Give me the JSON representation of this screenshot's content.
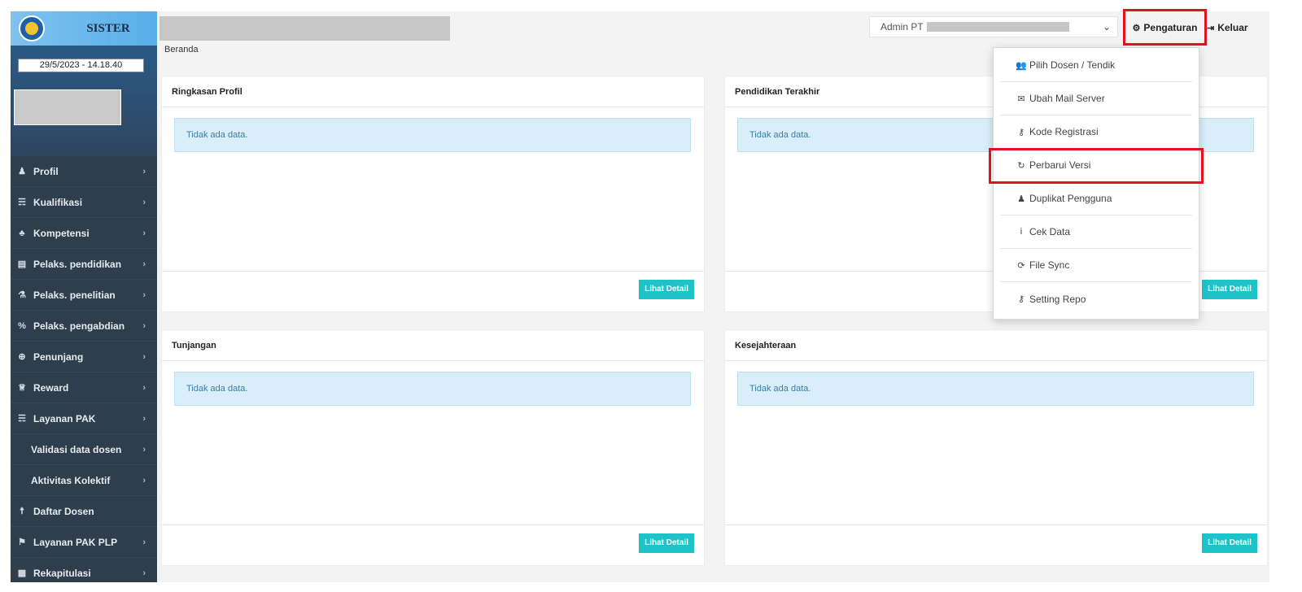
{
  "sidebar": {
    "brand": "SISTER",
    "datetime": "29/5/2023 - 14.18.40",
    "items": [
      {
        "label": "Profil",
        "icon": "user-icon",
        "glyph": "♟",
        "chevron": true
      },
      {
        "label": "Kualifikasi",
        "icon": "graduation-cap-icon",
        "glyph": "☴",
        "chevron": true
      },
      {
        "label": "Kompetensi",
        "icon": "group-icon",
        "glyph": "♣",
        "chevron": true
      },
      {
        "label": "Pelaks. pendidikan",
        "icon": "book-icon",
        "glyph": "▤",
        "chevron": true
      },
      {
        "label": "Pelaks. penelitian",
        "icon": "flask-icon",
        "glyph": "⚗",
        "chevron": true
      },
      {
        "label": "Pelaks. pengabdian",
        "icon": "percent-icon",
        "glyph": "%",
        "chevron": true
      },
      {
        "label": "Penunjang",
        "icon": "globe-icon",
        "glyph": "⊕",
        "chevron": true
      },
      {
        "label": "Reward",
        "icon": "trophy-icon",
        "glyph": "♕",
        "chevron": true
      },
      {
        "label": "Layanan PAK",
        "icon": "graduation-cap-icon",
        "glyph": "☴",
        "chevron": true
      },
      {
        "label": "Validasi data dosen",
        "icon": "",
        "glyph": "",
        "chevron": true,
        "sub": true
      },
      {
        "label": "Aktivitas Kolektif",
        "icon": "",
        "glyph": "",
        "chevron": true,
        "sub": true
      },
      {
        "label": "Daftar Dosen",
        "icon": "person-icon",
        "glyph": "☨",
        "chevron": false
      },
      {
        "label": "Layanan PAK PLP",
        "icon": "flag-icon",
        "glyph": "⚑",
        "chevron": true
      },
      {
        "label": "Rekapitulasi",
        "icon": "table-icon",
        "glyph": "▦",
        "chevron": true
      }
    ],
    "chevron_glyph": "›"
  },
  "topbar": {
    "breadcrumb": "Beranda",
    "user_prefix": "Admin PT",
    "caret": "⌄",
    "settings_label": "Pengaturan",
    "settings_glyph": "⚙",
    "logout_label": "Keluar",
    "logout_glyph": "⇥"
  },
  "panels": {
    "profil": {
      "title": "Ringkasan Profil",
      "empty": "Tidak ada data.",
      "button": "Lihat Detail"
    },
    "pendidikan": {
      "title": "Pendidikan Terakhir",
      "empty": "Tidak ada data.",
      "button": "Lihat Detail"
    },
    "tunjangan": {
      "title": "Tunjangan",
      "empty": "Tidak ada data.",
      "button": "Lihat Detail"
    },
    "kesejahteraan": {
      "title": "Kesejahteraan",
      "empty": "Tidak ada data.",
      "button": "Lihat Detail"
    }
  },
  "dropdown": {
    "items": [
      {
        "label": "Pilih Dosen / Tendik",
        "icon": "users-icon",
        "glyph": "👥"
      },
      {
        "label": "Ubah Mail Server",
        "icon": "envelope-icon",
        "glyph": "✉"
      },
      {
        "label": "Kode Registrasi",
        "icon": "key-icon",
        "glyph": "⚷"
      },
      {
        "label": "Perbarui Versi",
        "icon": "refresh-icon",
        "glyph": "↻"
      },
      {
        "label": "Duplikat Pengguna",
        "icon": "user-icon",
        "glyph": "♟"
      },
      {
        "label": "Cek Data",
        "icon": "info-icon",
        "glyph": "i"
      },
      {
        "label": "File Sync",
        "icon": "sync-icon",
        "glyph": "⟳"
      },
      {
        "label": "Setting Repo",
        "icon": "key-icon",
        "glyph": "⚷"
      }
    ]
  },
  "colors": {
    "sidebar_bg": "#2f3e4c",
    "brand_bg": "#58aee8",
    "button_teal": "#1ec3c9",
    "alert_bg": "#d9eef8",
    "highlight_red": "#e0141e"
  }
}
